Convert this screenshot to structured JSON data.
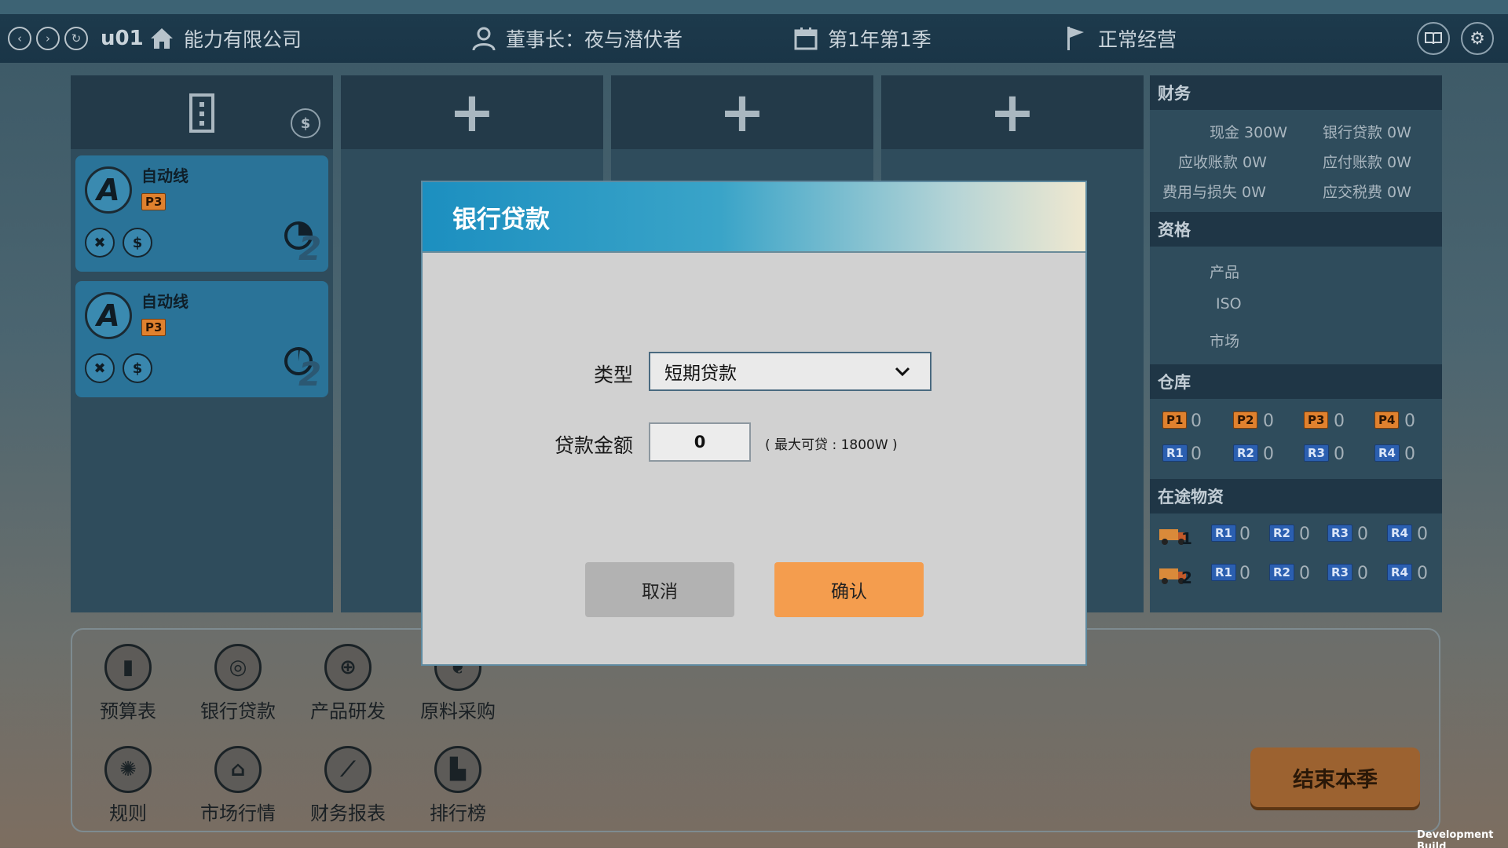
{
  "topbar": {
    "user_id": "u01",
    "company": "能力有限公司",
    "chairman": "董事长：夜与潜伏者",
    "period": "第1年第1季",
    "status": "正常经营"
  },
  "lines": [
    {
      "title": "自动线",
      "letter": "A",
      "product": "P3",
      "cycle": "2"
    },
    {
      "title": "自动线",
      "letter": "A",
      "product": "P3",
      "cycle": "2"
    }
  ],
  "factory": {
    "money_symbol": "$",
    "plus": "+"
  },
  "finance": {
    "header": "财务",
    "cash": "现金 300W",
    "bank_loan": "银行贷款 0W",
    "receivable": "应收账款 0W",
    "payable": "应付账款 0W",
    "expense": "费用与损失 0W",
    "tax": "应交税费 0W"
  },
  "qualification": {
    "header": "资格",
    "product": "产品",
    "iso": "ISO",
    "market": "市场"
  },
  "warehouse": {
    "header": "仓库",
    "products": [
      {
        "label": "P1",
        "qty": "0"
      },
      {
        "label": "P2",
        "qty": "0"
      },
      {
        "label": "P3",
        "qty": "0"
      },
      {
        "label": "P4",
        "qty": "0"
      }
    ],
    "materials": [
      {
        "label": "R1",
        "qty": "0"
      },
      {
        "label": "R2",
        "qty": "0"
      },
      {
        "label": "R3",
        "qty": "0"
      },
      {
        "label": "R4",
        "qty": "0"
      }
    ]
  },
  "transit": {
    "header": "在途物资",
    "rows": [
      {
        "truck": "1",
        "items": [
          {
            "label": "R1",
            "qty": "0"
          },
          {
            "label": "R2",
            "qty": "0"
          },
          {
            "label": "R3",
            "qty": "0"
          },
          {
            "label": "R4",
            "qty": "0"
          }
        ]
      },
      {
        "truck": "2",
        "items": [
          {
            "label": "R1",
            "qty": "0"
          },
          {
            "label": "R2",
            "qty": "0"
          },
          {
            "label": "R3",
            "qty": "0"
          },
          {
            "label": "R4",
            "qty": "0"
          }
        ]
      }
    ]
  },
  "tools": {
    "budget": "预算表",
    "loan": "银行贷款",
    "rnd": "产品研发",
    "purchase": "原料采购",
    "rules": "规则",
    "market": "市场行情",
    "report": "财务报表",
    "ranking": "排行榜"
  },
  "end_season": "结束本季",
  "dev_build": "Development Build",
  "modal": {
    "title": "银行贷款",
    "type_label": "类型",
    "type_value": "短期贷款",
    "amount_label": "贷款金额",
    "amount_value": "0",
    "max_note": "( 最大可贷 : 1800W )",
    "cancel": "取消",
    "confirm": "确认"
  },
  "colors": {
    "accent_orange": "#f49d4e",
    "card_blue": "#2a7398",
    "header_gradient_start": "#1c8fc0"
  }
}
